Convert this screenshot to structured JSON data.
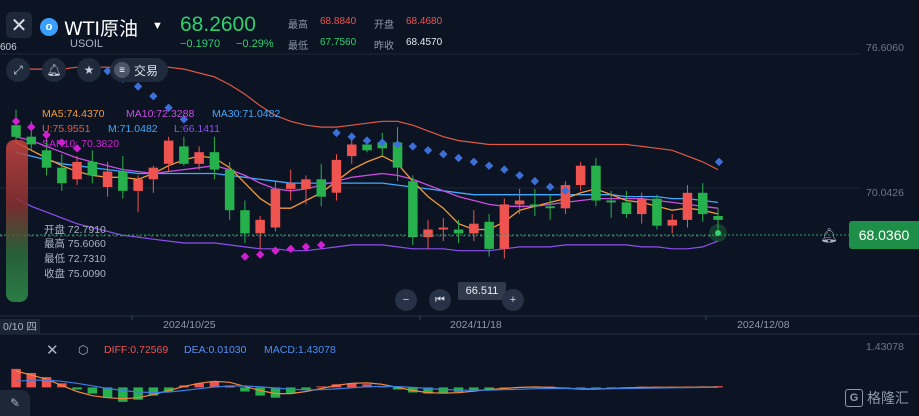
{
  "header": {
    "instrument_name": "WTI原油",
    "instrument_code": "USOIL",
    "last_price": "68.2600",
    "change": "−0.1970",
    "change_percent": "−0.29%",
    "logo_glyph": "o",
    "stats": {
      "high_label": "最高",
      "high_value": "68.8840",
      "open_label": "开盘",
      "open_value": "68.4680",
      "low_label": "最低",
      "low_value": "67.7560",
      "prev_close_label": "昨收",
      "prev_close_value": "68.4570"
    },
    "left_partial_number": "606"
  },
  "toolbar": {
    "trade_label": "交易",
    "icons": [
      "expand-icon",
      "bell-icon",
      "star-icon",
      "menu-icon"
    ]
  },
  "indicators": {
    "ma5": "MA5:74.4370",
    "ma10": "MA10:72.3288",
    "ma30": "MA30:71.0482",
    "boll_u": "U:75.9551",
    "boll_m": "M:71.0482",
    "boll_l": "L:66.1411",
    "sar": "SAR10: 70.3820"
  },
  "ohlc_tooltip": {
    "open": "开盘 72.7910",
    "high": "最高 75.6060",
    "low": "最低 72.7310",
    "close": "收盘 75.0090"
  },
  "price_axis": {
    "top_label": "76.6060",
    "mid_label": "70.0426",
    "current_price": "68.0360"
  },
  "crosshair_label": "66.511",
  "time_axis": {
    "left_partial": "0/10 四",
    "dates": [
      "2024/10/25",
      "2024/11/18",
      "2024/12/08"
    ]
  },
  "macd": {
    "diff": "DIFF:0.72569",
    "dea": "DEA:0.01030",
    "macd": "MACD:1.43078",
    "axis_top": "1.43078"
  },
  "brand": {
    "text": "格隆汇",
    "glyph": "G"
  },
  "colors": {
    "up": "#ef5350",
    "down": "#26b14c",
    "ma5": "#f29a38",
    "ma10": "#c94ee0",
    "ma30": "#3fa8ff",
    "boll": "#e05a43",
    "boll_lower": "#8c4ff0",
    "sar_down": "#3c6fd8",
    "sar_up": "#d11fd1",
    "diff": "#f2883a",
    "dea": "#3d7de0",
    "background": "#0c1424"
  },
  "chart_data": {
    "type": "candlestick",
    "candles": [
      {
        "o": 73.2,
        "h": 74.0,
        "l": 72.3,
        "c": 72.6
      },
      {
        "o": 72.6,
        "h": 73.4,
        "l": 71.9,
        "c": 72.2
      },
      {
        "o": 71.9,
        "h": 72.6,
        "l": 70.6,
        "c": 71.0
      },
      {
        "o": 71.0,
        "h": 71.7,
        "l": 69.8,
        "c": 70.2
      },
      {
        "o": 70.4,
        "h": 71.6,
        "l": 70.1,
        "c": 71.3
      },
      {
        "o": 71.3,
        "h": 71.9,
        "l": 70.2,
        "c": 70.6
      },
      {
        "o": 70.0,
        "h": 71.3,
        "l": 69.5,
        "c": 70.8
      },
      {
        "o": 70.8,
        "h": 71.6,
        "l": 69.4,
        "c": 69.8
      },
      {
        "o": 69.8,
        "h": 70.6,
        "l": 68.7,
        "c": 70.4
      },
      {
        "o": 70.4,
        "h": 71.1,
        "l": 69.7,
        "c": 71.0
      },
      {
        "o": 71.2,
        "h": 72.6,
        "l": 70.8,
        "c": 72.4
      },
      {
        "o": 72.1,
        "h": 72.6,
        "l": 71.1,
        "c": 71.2
      },
      {
        "o": 71.2,
        "h": 72.1,
        "l": 70.9,
        "c": 71.8
      },
      {
        "o": 71.8,
        "h": 72.6,
        "l": 70.4,
        "c": 70.9
      },
      {
        "o": 70.9,
        "h": 71.3,
        "l": 68.3,
        "c": 68.8
      },
      {
        "o": 68.8,
        "h": 69.3,
        "l": 67.1,
        "c": 67.6
      },
      {
        "o": 67.6,
        "h": 68.5,
        "l": 66.8,
        "c": 68.3
      },
      {
        "o": 67.9,
        "h": 70.3,
        "l": 67.7,
        "c": 69.9
      },
      {
        "o": 69.9,
        "h": 70.9,
        "l": 69.3,
        "c": 70.2
      },
      {
        "o": 69.9,
        "h": 70.6,
        "l": 69.1,
        "c": 70.4
      },
      {
        "o": 70.4,
        "h": 71.2,
        "l": 69.0,
        "c": 69.5
      },
      {
        "o": 69.7,
        "h": 71.7,
        "l": 69.3,
        "c": 71.4
      },
      {
        "o": 71.6,
        "h": 72.6,
        "l": 71.2,
        "c": 72.2
      },
      {
        "o": 72.2,
        "h": 72.6,
        "l": 71.8,
        "c": 71.9
      },
      {
        "o": 72.3,
        "h": 72.8,
        "l": 71.6,
        "c": 72.0
      },
      {
        "o": 72.3,
        "h": 73.1,
        "l": 70.3,
        "c": 71.0
      },
      {
        "o": 70.3,
        "h": 70.6,
        "l": 67.0,
        "c": 67.4
      },
      {
        "o": 67.4,
        "h": 68.3,
        "l": 66.8,
        "c": 67.8
      },
      {
        "o": 67.8,
        "h": 68.4,
        "l": 67.2,
        "c": 67.9
      },
      {
        "o": 67.8,
        "h": 68.3,
        "l": 67.1,
        "c": 67.6
      },
      {
        "o": 67.6,
        "h": 68.8,
        "l": 67.2,
        "c": 68.1
      },
      {
        "o": 68.2,
        "h": 68.6,
        "l": 66.4,
        "c": 66.8
      },
      {
        "o": 66.8,
        "h": 69.4,
        "l": 66.3,
        "c": 69.1
      },
      {
        "o": 69.1,
        "h": 69.9,
        "l": 68.6,
        "c": 69.3
      },
      {
        "o": 69.1,
        "h": 69.9,
        "l": 68.5,
        "c": 69.0
      },
      {
        "o": 69.0,
        "h": 69.6,
        "l": 68.3,
        "c": 68.9
      },
      {
        "o": 68.9,
        "h": 70.3,
        "l": 68.6,
        "c": 70.1
      },
      {
        "o": 70.1,
        "h": 71.3,
        "l": 69.8,
        "c": 71.1
      },
      {
        "o": 71.1,
        "h": 71.5,
        "l": 69.0,
        "c": 69.3
      },
      {
        "o": 69.3,
        "h": 69.8,
        "l": 68.4,
        "c": 69.2
      },
      {
        "o": 69.2,
        "h": 69.8,
        "l": 68.4,
        "c": 68.6
      },
      {
        "o": 68.6,
        "h": 69.7,
        "l": 68.1,
        "c": 69.4
      },
      {
        "o": 69.4,
        "h": 69.6,
        "l": 67.8,
        "c": 68.0
      },
      {
        "o": 68.0,
        "h": 68.6,
        "l": 67.6,
        "c": 68.3
      },
      {
        "o": 68.3,
        "h": 70.1,
        "l": 67.9,
        "c": 69.7
      },
      {
        "o": 69.7,
        "h": 70.2,
        "l": 68.2,
        "c": 68.6
      },
      {
        "o": 68.5,
        "h": 68.9,
        "l": 67.8,
        "c": 68.3
      }
    ],
    "ma5": [
      72.3,
      71.9,
      71.5,
      71.1,
      70.8,
      70.6,
      70.5,
      70.5,
      70.4,
      70.7,
      71.1,
      71.4,
      71.6,
      71.5,
      71.0,
      70.2,
      69.4,
      68.9,
      68.9,
      69.3,
      69.7,
      70.3,
      70.9,
      71.3,
      71.6,
      71.2,
      70.3,
      69.5,
      68.9,
      68.1,
      67.8,
      67.8,
      68.2,
      68.8,
      69.0,
      69.2,
      69.4,
      69.7,
      69.9,
      69.6,
      69.3,
      69.2,
      69.0,
      68.8,
      68.9,
      68.8,
      68.6
    ],
    "ma10": [
      72.6,
      72.4,
      72.1,
      71.8,
      71.5,
      71.3,
      71.1,
      70.9,
      70.8,
      70.7,
      70.8,
      70.9,
      71.0,
      71.1,
      70.9,
      70.6,
      70.2,
      69.9,
      69.8,
      69.9,
      70.1,
      70.3,
      70.5,
      70.6,
      70.7,
      70.6,
      70.4,
      70.1,
      69.8,
      69.5,
      69.3,
      69.1,
      69.0,
      69.0,
      69.0,
      69.1,
      69.2,
      69.3,
      69.4,
      69.4,
      69.4,
      69.4,
      69.3,
      69.2,
      69.1,
      69.0,
      68.9
    ],
    "ma30": [
      71.8,
      71.6,
      71.4,
      71.2,
      71.1,
      71.0,
      70.9,
      70.8,
      70.7,
      70.7,
      70.7,
      70.7,
      70.7,
      70.7,
      70.6,
      70.5,
      70.4,
      70.3,
      70.2,
      70.2,
      70.2,
      70.2,
      70.2,
      70.2,
      70.2,
      70.1,
      70.0,
      69.9,
      69.8,
      69.7,
      69.6,
      69.6,
      69.6,
      69.6,
      69.6,
      69.6,
      69.6,
      69.6,
      69.6,
      69.6,
      69.5,
      69.5,
      69.5,
      69.4,
      69.4,
      69.3,
      69.2
    ],
    "boll_upper": [
      76.2,
      76.1,
      76.1,
      76.1,
      76.2,
      76.2,
      76.2,
      76.2,
      76.2,
      76.2,
      76.2,
      76.1,
      75.9,
      75.7,
      75.3,
      74.8,
      74.2,
      73.7,
      73.4,
      73.2,
      73.1,
      73.1,
      73.2,
      73.3,
      73.4,
      73.4,
      73.2,
      72.9,
      72.6,
      72.4,
      72.3,
      72.2,
      72.2,
      72.2,
      72.2,
      72.2,
      72.2,
      72.2,
      72.2,
      72.2,
      72.2,
      72.1,
      72.0,
      71.9,
      71.6,
      71.3,
      70.9
    ],
    "boll_lower": [
      69.4,
      69.0,
      68.7,
      68.4,
      68.1,
      67.9,
      67.7,
      67.5,
      67.4,
      67.3,
      67.2,
      67.1,
      67.1,
      67.1,
      67.0,
      66.9,
      66.8,
      66.8,
      66.7,
      66.7,
      66.8,
      66.9,
      67.0,
      67.0,
      67.0,
      66.9,
      66.8,
      66.8,
      66.8,
      66.7,
      66.7,
      66.7,
      66.8,
      66.9,
      66.9,
      66.9,
      67.0,
      67.0,
      67.0,
      67.0,
      67.0,
      66.9,
      66.9,
      66.8,
      66.8,
      66.9,
      67.2
    ],
    "sar": [
      73.4,
      73.1,
      72.7,
      72.3,
      72.0,
      null,
      null,
      null,
      null,
      null,
      null,
      null,
      null,
      null,
      null,
      66.4,
      66.5,
      66.7,
      66.8,
      66.9,
      67.0,
      null,
      null,
      null,
      null,
      null,
      null,
      null,
      null,
      null,
      null,
      null,
      null,
      null,
      null,
      null,
      null,
      null,
      null,
      null,
      null,
      null,
      null,
      null,
      null,
      null,
      null
    ],
    "sar_upper": [
      null,
      null,
      null,
      null,
      null,
      76.3,
      76.0,
      75.6,
      75.2,
      74.7,
      74.1,
      73.5,
      null,
      null,
      null,
      null,
      null,
      null,
      null,
      null,
      null,
      72.8,
      72.6,
      72.4,
      72.3,
      72.2,
      72.1,
      71.9,
      71.7,
      71.5,
      71.3,
      71.1,
      70.9,
      70.6,
      70.3,
      70.0,
      69.8,
      null,
      null,
      null,
      null,
      null,
      null,
      null,
      null,
      null,
      null
    ],
    "macd_hist": [
      0.9,
      0.7,
      0.5,
      0.2,
      -0.1,
      -0.3,
      -0.5,
      -0.7,
      -0.6,
      -0.4,
      -0.2,
      0.1,
      0.2,
      0.3,
      0.1,
      -0.2,
      -0.4,
      -0.5,
      -0.3,
      -0.1,
      0.05,
      0.15,
      0.2,
      0.15,
      0.05,
      -0.1,
      -0.25,
      -0.3,
      -0.28,
      -0.22,
      -0.15,
      -0.1,
      -0.05,
      0.02,
      0.05,
      0.04,
      -0.02,
      -0.08,
      -0.1,
      -0.06,
      -0.03,
      0.03,
      0.04,
      0.03,
      0.04,
      0.05,
      0.06
    ],
    "macd_diff": [
      0.8,
      0.6,
      0.4,
      0.1,
      -0.2,
      -0.4,
      -0.5,
      -0.55,
      -0.5,
      -0.35,
      -0.15,
      0.05,
      0.2,
      0.3,
      0.25,
      0.05,
      -0.15,
      -0.3,
      -0.3,
      -0.2,
      -0.05,
      0.1,
      0.2,
      0.22,
      0.15,
      0.0,
      -0.15,
      -0.25,
      -0.28,
      -0.25,
      -0.18,
      -0.1,
      -0.05,
      0.0,
      0.02,
      0.0,
      -0.04,
      -0.08,
      -0.08,
      -0.05,
      -0.02,
      0.0,
      0.0,
      0.01,
      0.01,
      0.02,
      0.02
    ],
    "macd_dea": [
      0.3,
      0.35,
      0.36,
      0.3,
      0.2,
      0.08,
      -0.05,
      -0.15,
      -0.22,
      -0.25,
      -0.22,
      -0.15,
      -0.06,
      0.02,
      0.07,
      0.07,
      0.03,
      -0.03,
      -0.09,
      -0.12,
      -0.11,
      -0.07,
      -0.02,
      0.03,
      0.05,
      0.04,
      0.0,
      -0.05,
      -0.1,
      -0.13,
      -0.14,
      -0.13,
      -0.11,
      -0.09,
      -0.06,
      -0.05,
      -0.05,
      -0.05,
      -0.06,
      -0.06,
      -0.05,
      -0.04,
      -0.03,
      -0.02,
      -0.01,
      0.0,
      0.0
    ],
    "ylim": [
      65.6,
      77.4
    ],
    "macd_ylim": [
      -1.0,
      1.43078
    ]
  }
}
